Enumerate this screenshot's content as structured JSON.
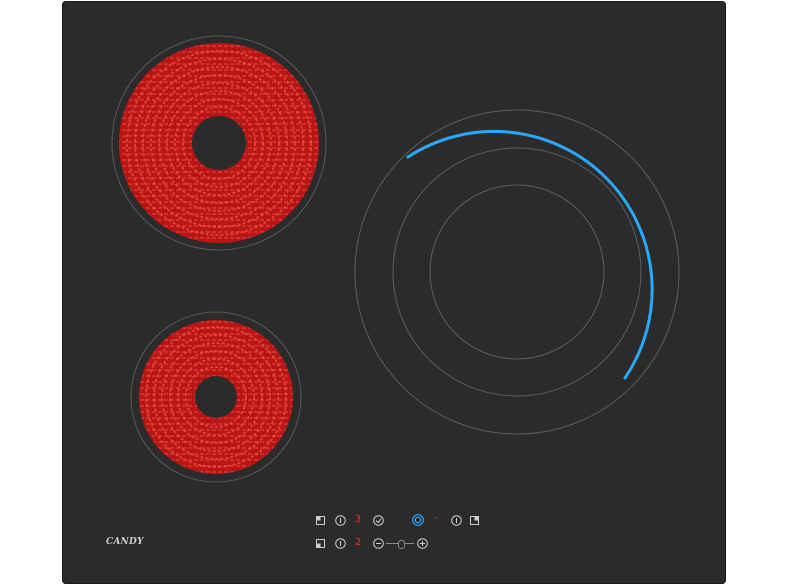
{
  "product": {
    "brand_logo_text": "CANDY",
    "surface_color": "#2b2b2b",
    "element_glow_color": "#c81e1e",
    "indicator_color": "#2aa8ff"
  },
  "controls": {
    "top_row_timer_digit": "3",
    "bottom_row_timer_digit": "2",
    "right_zone_dot": "·",
    "icons": [
      "zone-select-icon",
      "power-icon",
      "check-icon",
      "bridge-zone-icon",
      "power-icon",
      "zone-select-icon",
      "zone-select-icon",
      "power-icon",
      "minus-icon",
      "slider-track",
      "plus-icon"
    ]
  }
}
